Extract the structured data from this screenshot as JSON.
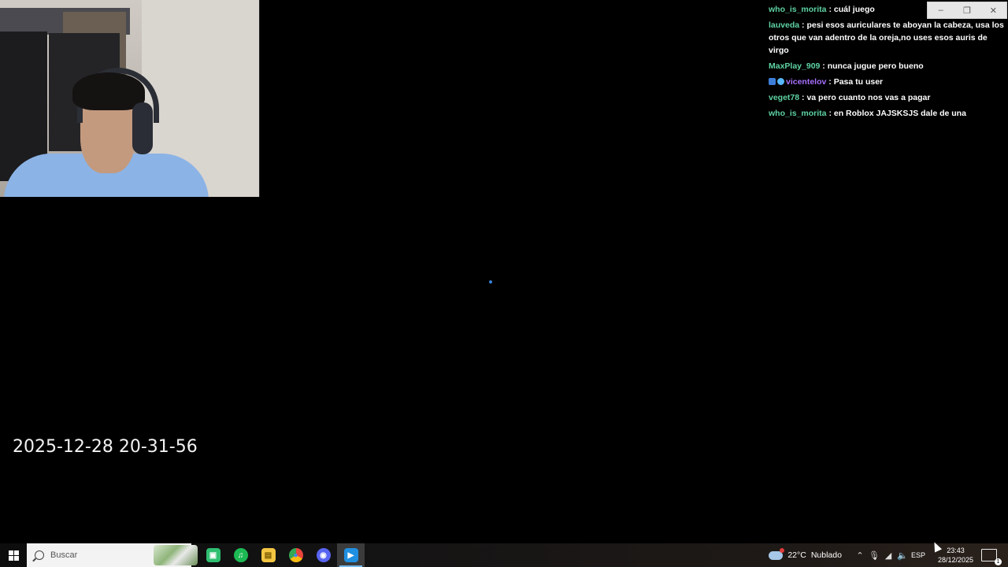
{
  "chat": {
    "messages": [
      {
        "user": "who_is_morita",
        "text": " : cuál juego"
      },
      {
        "user": "lauveda",
        "text": " : pesi esos auriculares te aboyan la cabeza, usa los otros que van adentro de la oreja,no uses esos auris de virgo"
      },
      {
        "user": "MaxPlay_909",
        "text": " : nunca jugue pero bueno"
      },
      {
        "user": "vicentelov",
        "text": " : Pasa tu user"
      },
      {
        "user": "veget78",
        "text": " : va pero cuanto nos vas a pagar"
      },
      {
        "user": "who_is_morita",
        "text": " : en Roblox JAJSKSJS dale de una"
      }
    ],
    "name_color": "#5ed3a3",
    "special_name_color": "#a970ff"
  },
  "window_controls": {
    "minimize": "–",
    "restore": "❐",
    "close": "✕"
  },
  "overlay": {
    "timestamp": "2025-12-28 20-31-56"
  },
  "taskbar": {
    "search_placeholder": "Buscar",
    "apps": [
      {
        "name": "meet-app",
        "icon": "▣",
        "color": "#2fbf71"
      },
      {
        "name": "spotify",
        "icon": "♫",
        "color": "#1db954"
      },
      {
        "name": "file-explorer",
        "icon": "▤",
        "color": "#f4c542"
      },
      {
        "name": "chrome",
        "icon": "●",
        "color": "#e8453c"
      },
      {
        "name": "discord",
        "icon": "◉",
        "color": "#5865f2"
      },
      {
        "name": "media-app",
        "icon": "▶",
        "color": "#1f8fe0"
      }
    ],
    "weather": {
      "temp": "22°C",
      "condition": "Nublado"
    },
    "tray_lang": "ESP",
    "clock_time": "23:43",
    "clock_date": "28/12/2025"
  }
}
